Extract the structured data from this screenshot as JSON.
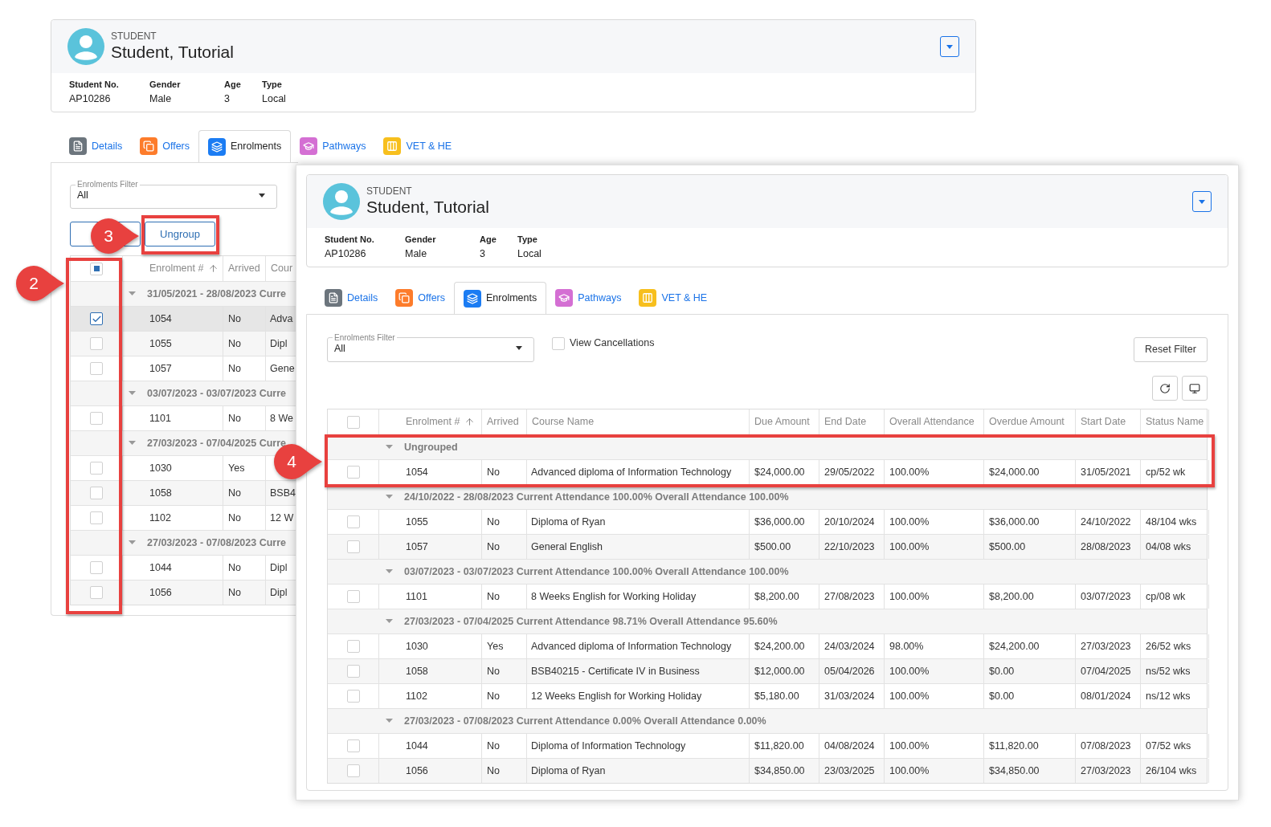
{
  "back_window": {
    "header": {
      "kind_label": "STUDENT",
      "name": "Student, Tutorial",
      "fields": [
        {
          "label": "Student No.",
          "value": "AP10286"
        },
        {
          "label": "Gender",
          "value": "Male"
        },
        {
          "label": "Age",
          "value": "3"
        },
        {
          "label": "Type",
          "value": "Local"
        }
      ]
    },
    "tabs": [
      {
        "label": "Details",
        "kind": "details",
        "color": "#6c757d",
        "selected": false
      },
      {
        "label": "Offers",
        "kind": "offers",
        "color": "#fd7c2b",
        "selected": false
      },
      {
        "label": "Enrolments",
        "kind": "enrolments",
        "color": "#1b7cf3",
        "selected": true
      },
      {
        "label": "Pathways",
        "kind": "pathways",
        "color": "#d46fd3",
        "selected": false
      },
      {
        "label": "VET & HE",
        "kind": "vet",
        "color": "#f7bf1d",
        "selected": false
      }
    ],
    "filter": {
      "label": "Enrolments Filter",
      "value": "All"
    },
    "ungroup_button": "Ungroup",
    "table": {
      "select_all": {
        "indeterminate": true
      },
      "columns": [
        {
          "label": "Enrolment #",
          "sorted": true
        },
        {
          "label": "Arrived",
          "sorted": false
        },
        {
          "label": "Cour",
          "sorted": false
        }
      ],
      "groups": [
        {
          "title": "31/05/2021 - 28/08/2023 Curre",
          "expanded": true,
          "rows": [
            {
              "cells": [
                "1054",
                "No",
                "Adva"
              ],
              "checked": true,
              "selected": true
            },
            {
              "cells": [
                "1055",
                "No",
                "Dipl"
              ],
              "checked": false,
              "selected": false
            },
            {
              "cells": [
                "1057",
                "No",
                "Gene"
              ],
              "checked": false,
              "selected": false
            }
          ]
        },
        {
          "title": "03/07/2023 - 03/07/2023 Curre",
          "expanded": true,
          "rows": [
            {
              "cells": [
                "1101",
                "No",
                "8 We"
              ],
              "checked": false,
              "selected": false
            }
          ]
        },
        {
          "title": "27/03/2023 - 07/04/2025 Curre",
          "expanded": true,
          "rows": [
            {
              "cells": [
                "1030",
                "Yes"
              ],
              "checked": false,
              "selected": false
            },
            {
              "cells": [
                "1058",
                "No",
                "BSB4"
              ],
              "checked": false,
              "selected": false
            },
            {
              "cells": [
                "1102",
                "No",
                "12 W"
              ],
              "checked": false,
              "selected": false
            }
          ]
        },
        {
          "title": "27/03/2023 - 07/08/2023 Curre",
          "expanded": true,
          "rows": [
            {
              "cells": [
                "1044",
                "No",
                "Dipl"
              ],
              "checked": false,
              "selected": false
            },
            {
              "cells": [
                "1056",
                "No",
                "Dipl"
              ],
              "checked": false,
              "selected": false
            }
          ]
        }
      ]
    }
  },
  "front_window": {
    "header": {
      "kind_label": "STUDENT",
      "name": "Student, Tutorial",
      "fields": [
        {
          "label": "Student No.",
          "value": "AP10286"
        },
        {
          "label": "Gender",
          "value": "Male"
        },
        {
          "label": "Age",
          "value": "3"
        },
        {
          "label": "Type",
          "value": "Local"
        }
      ]
    },
    "tabs": [
      {
        "label": "Details",
        "kind": "details",
        "color": "#6c757d",
        "selected": false
      },
      {
        "label": "Offers",
        "kind": "offers",
        "color": "#fd7c2b",
        "selected": false
      },
      {
        "label": "Enrolments",
        "kind": "enrolments",
        "color": "#1b7cf3",
        "selected": true
      },
      {
        "label": "Pathways",
        "kind": "pathways",
        "color": "#d46fd3",
        "selected": false
      },
      {
        "label": "VET & HE",
        "kind": "vet",
        "color": "#f7bf1d",
        "selected": false
      }
    ],
    "filter": {
      "label": "Enrolments Filter",
      "value": "All"
    },
    "view_cancellations": {
      "label": "View Cancellations",
      "checked": false
    },
    "reset_button": "Reset Filter",
    "table": {
      "select_all": {
        "indeterminate": false
      },
      "columns": [
        {
          "label": "Enrolment #",
          "sorted": true
        },
        {
          "label": "Arrived",
          "sorted": false
        },
        {
          "label": "Course Name",
          "sorted": false
        },
        {
          "label": "Due Amount",
          "sorted": false
        },
        {
          "label": "End Date",
          "sorted": false
        },
        {
          "label": "Overall Attendance",
          "sorted": false
        },
        {
          "label": "Overdue Amount",
          "sorted": false
        },
        {
          "label": "Start Date",
          "sorted": false
        },
        {
          "label": "Status Name",
          "sorted": false
        }
      ],
      "groups": [
        {
          "title": "Ungrouped",
          "expanded": true,
          "rows": [
            {
              "cells": [
                "1054",
                "No",
                "Advanced diploma of Information Technology",
                "$24,000.00",
                "29/05/2022",
                "100.00%",
                "$24,000.00",
                "31/05/2021",
                "cp/52 wk"
              ],
              "checked": false,
              "selected": false
            }
          ]
        },
        {
          "title": "24/10/2022 - 28/08/2023 Current Attendance 100.00% Overall Attendance 100.00%",
          "expanded": true,
          "rows": [
            {
              "cells": [
                "1055",
                "No",
                "Diploma of Ryan",
                "$36,000.00",
                "20/10/2024",
                "100.00%",
                "$36,000.00",
                "24/10/2022",
                "48/104 wks"
              ],
              "checked": false,
              "selected": false
            },
            {
              "cells": [
                "1057",
                "No",
                "General English",
                "$500.00",
                "22/10/2023",
                "100.00%",
                "$500.00",
                "28/08/2023",
                "04/08 wks"
              ],
              "checked": false,
              "selected": false
            }
          ]
        },
        {
          "title": "03/07/2023 - 03/07/2023 Current Attendance 100.00% Overall Attendance 100.00%",
          "expanded": true,
          "rows": [
            {
              "cells": [
                "1101",
                "No",
                "8 Weeks English for Working Holiday",
                "$8,200.00",
                "27/08/2023",
                "100.00%",
                "$8,200.00",
                "03/07/2023",
                "cp/08 wk"
              ],
              "checked": false,
              "selected": false
            }
          ]
        },
        {
          "title": "27/03/2023 - 07/04/2025 Current Attendance 98.71% Overall Attendance 95.60%",
          "expanded": true,
          "rows": [
            {
              "cells": [
                "1030",
                "Yes",
                "Advanced diploma of Information Technology",
                "$24,200.00",
                "24/03/2024",
                "98.00%",
                "$24,200.00",
                "27/03/2023",
                "26/52 wks"
              ],
              "checked": false,
              "selected": false
            },
            {
              "cells": [
                "1058",
                "No",
                "BSB40215 - Certificate IV in Business",
                "$12,000.00",
                "05/04/2026",
                "100.00%",
                "$0.00",
                "07/04/2025",
                "ns/52 wks"
              ],
              "checked": false,
              "selected": false
            },
            {
              "cells": [
                "1102",
                "No",
                "12 Weeks English for Working Holiday",
                "$5,180.00",
                "31/03/2024",
                "100.00%",
                "$0.00",
                "08/01/2024",
                "ns/12 wks"
              ],
              "checked": false,
              "selected": false
            }
          ]
        },
        {
          "title": "27/03/2023 - 07/08/2023 Current Attendance 0.00% Overall Attendance 0.00%",
          "expanded": true,
          "rows": [
            {
              "cells": [
                "1044",
                "No",
                "Diploma of Information Technology",
                "$11,820.00",
                "04/08/2024",
                "100.00%",
                "$11,820.00",
                "07/08/2023",
                "07/52 wks"
              ],
              "checked": false,
              "selected": false
            },
            {
              "cells": [
                "1056",
                "No",
                "Diploma of Ryan",
                "$34,850.00",
                "23/03/2025",
                "100.00%",
                "$34,850.00",
                "27/03/2023",
                "26/104 wks"
              ],
              "checked": false,
              "selected": false
            }
          ]
        }
      ]
    }
  },
  "annotations": [
    {
      "number": "2"
    },
    {
      "number": "3"
    },
    {
      "number": "4"
    }
  ]
}
